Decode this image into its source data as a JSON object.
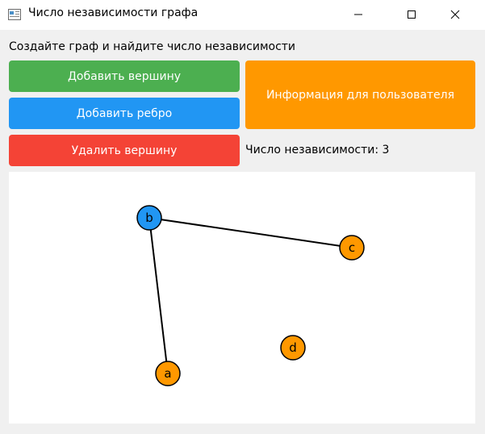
{
  "window": {
    "title": "Число независимости графа"
  },
  "header": {
    "instruction": "Создайте граф и найдите число независимости"
  },
  "buttons": {
    "add_vertex": "Добавить вершину",
    "add_edge": "Добавить ребро",
    "delete_vertex": "Удалить вершину",
    "user_info": "Информация для пользователя"
  },
  "result": {
    "independence_number_text": "Число независимости: 3"
  },
  "graph": {
    "nodes": [
      {
        "id": "b",
        "label": "b",
        "color": "#2196f3"
      },
      {
        "id": "c",
        "label": "c",
        "color": "#ff9800"
      },
      {
        "id": "a",
        "label": "a",
        "color": "#ff9800"
      },
      {
        "id": "d",
        "label": "d",
        "color": "#ff9800"
      }
    ],
    "edges": [
      [
        "b",
        "c"
      ],
      [
        "b",
        "a"
      ]
    ]
  },
  "colors": {
    "add_vertex": "#4caf50",
    "add_edge": "#2196f3",
    "delete_vertex": "#f44336",
    "user_info": "#ff9800"
  }
}
